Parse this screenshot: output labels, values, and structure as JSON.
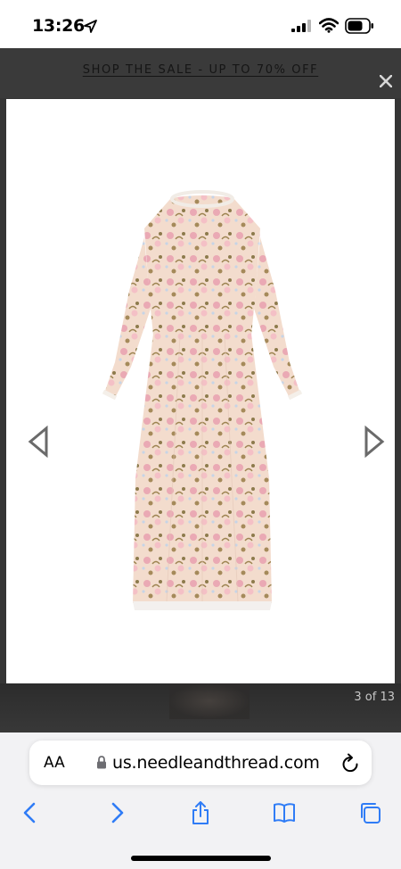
{
  "status_bar": {
    "time": "13:26",
    "icons": [
      "location-arrow-icon",
      "cellular-signal-icon",
      "wifi-icon",
      "battery-icon"
    ]
  },
  "promo_banner": {
    "text": "SHOP THE SALE - UP TO 70% OFF",
    "close_icon": "close-icon"
  },
  "gallery": {
    "image_description_icon": "dress-image",
    "prev_icon": "triangle-left-outline-icon",
    "next_icon": "triangle-right-outline-icon",
    "counter": "3 of 13"
  },
  "browser": {
    "aa_label": "AA",
    "url": "us.needleandthread.com",
    "toolbar": [
      "back-icon",
      "forward-icon",
      "share-icon",
      "bookmarks-icon",
      "tabs-icon"
    ],
    "accent_color": "#1a73e8"
  },
  "colors": {
    "overlay": "#353535",
    "panel": "#ffffff",
    "browser_chrome": "#f2f2f4",
    "toolbar_blue": "#2f7cf6"
  }
}
